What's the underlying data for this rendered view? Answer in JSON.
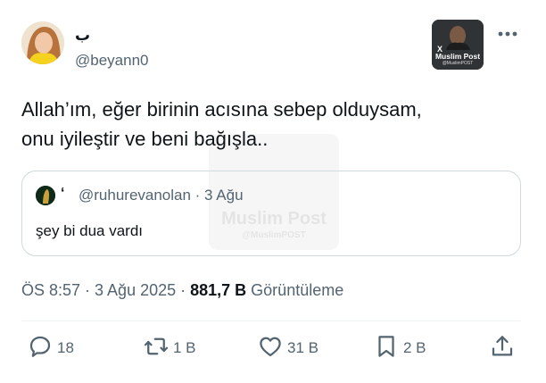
{
  "author": {
    "display_name": "ب",
    "handle": "@beyann0"
  },
  "badge": {
    "x_mark": "X",
    "title": "Muslim Post",
    "subtitle": "@MuslimPOST"
  },
  "tweet": {
    "text_line1": "Allah’ım, eğer birinin acısına sebep olduysam,",
    "text_line2": "onu iyileştir ve beni bağışla.."
  },
  "watermark": {
    "title": "Muslim Post",
    "subtitle": "@MuslimPOST"
  },
  "quote": {
    "name": "‘",
    "meta": "@ruhurevanolan · 3 Ağu",
    "text": "şey bi dua vardı"
  },
  "meta": {
    "time": "ÖS 8:57 · 3 Ağu 2025 · ",
    "views": "881,7 B",
    "views_label": " Görüntüleme"
  },
  "actions": {
    "replies": "18",
    "reposts": "1 B",
    "likes": "31 B",
    "bookmarks": "2 B"
  },
  "colors": {
    "text": "#0f1419",
    "secondary": "#536471",
    "border": "#cfd9de"
  },
  "icons": [
    "more-icon",
    "reply-icon",
    "repost-icon",
    "like-icon",
    "bookmark-icon",
    "share-icon"
  ]
}
